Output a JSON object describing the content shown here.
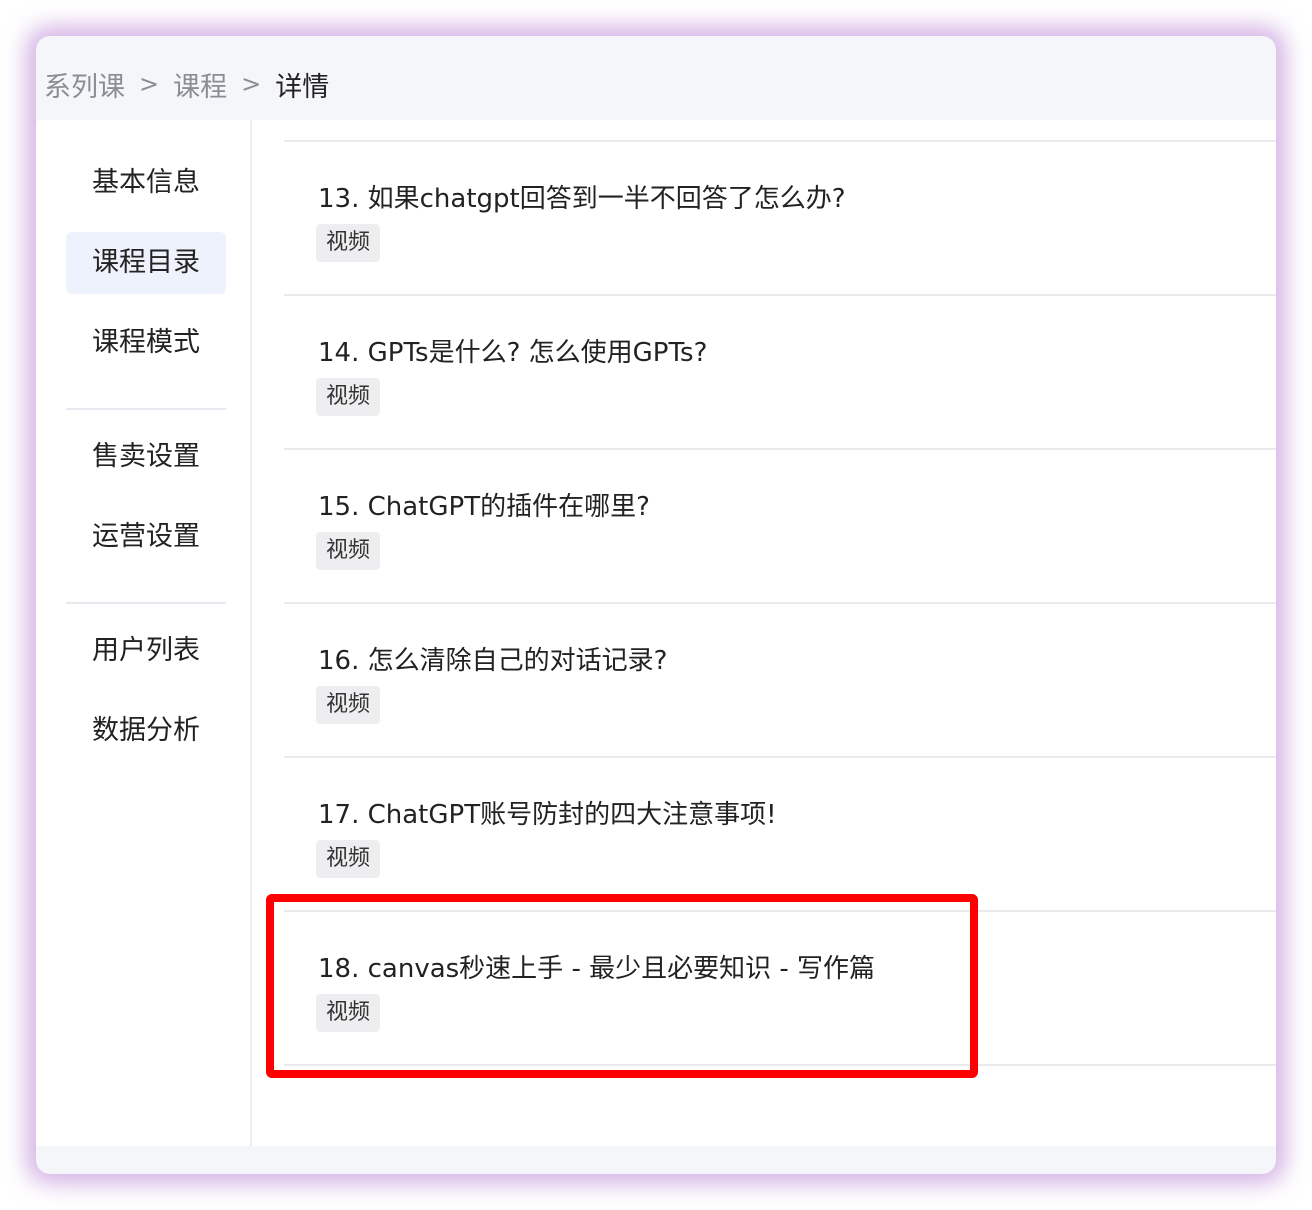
{
  "breadcrumb": {
    "items": [
      "系列课",
      "课程",
      "详情"
    ],
    "separator": ">"
  },
  "sidebar": {
    "groups": [
      [
        "基本信息",
        "课程目录",
        "课程模式"
      ],
      [
        "售卖设置",
        "运营设置"
      ],
      [
        "用户列表",
        "数据分析"
      ]
    ],
    "active": "课程目录"
  },
  "catalog": {
    "items": [
      {
        "title": "13. 如果chatgpt回答到一半不回答了怎么办?",
        "tag": "视频"
      },
      {
        "title": "14. GPTs是什么? 怎么使用GPTs?",
        "tag": "视频"
      },
      {
        "title": "15. ChatGPT的插件在哪里?",
        "tag": "视频"
      },
      {
        "title": "16. 怎么清除自己的对话记录?",
        "tag": "视频"
      },
      {
        "title": "17. ChatGPT账号防封的四大注意事项!",
        "tag": "视频"
      },
      {
        "title": "18. canvas秒速上手 - 最少且必要知识 - 写作篇",
        "tag": "视频"
      }
    ],
    "highlighted_index": 5
  },
  "colors": {
    "highlight_border": "#ff0000",
    "active_nav_bg": "#eef2fc",
    "frame_glow": "#b478d2"
  }
}
